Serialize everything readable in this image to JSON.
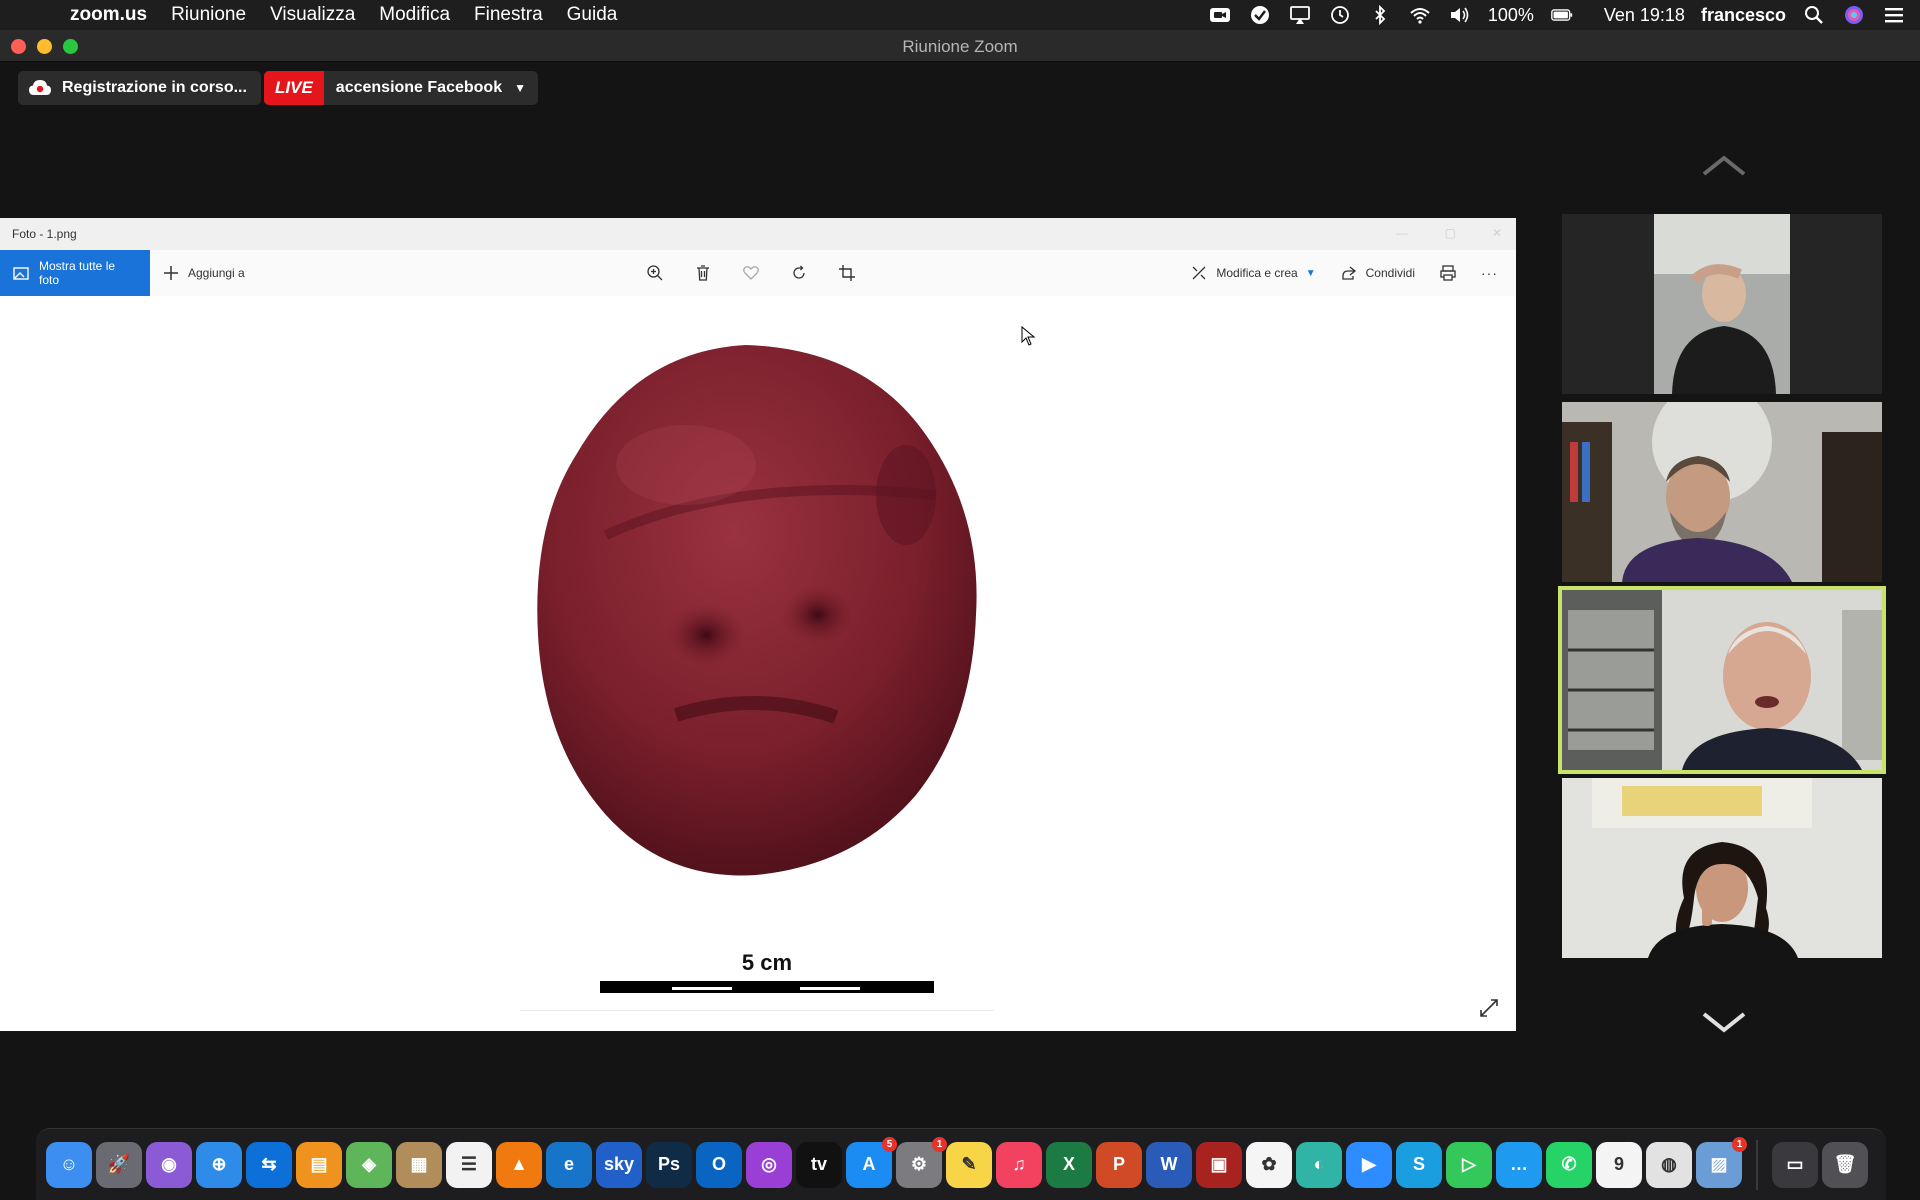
{
  "menubar": {
    "app_name": "zoom.us",
    "menus": [
      "Riunione",
      "Visualizza",
      "Modifica",
      "Finestra",
      "Guida"
    ],
    "battery": "100%",
    "clock": "Ven 19:18",
    "user": "francesco"
  },
  "zoom": {
    "window_title": "Riunione Zoom",
    "recording_label": "Registrazione in corso...",
    "live_badge": "LIVE",
    "live_label": "accensione Facebook"
  },
  "photos": {
    "title": "Foto - 1.png",
    "show_all_label": "Mostra tutte le foto",
    "add_label": "Aggiungi a",
    "edit_label": "Modifica e crea",
    "share_label": "Condividi",
    "more_label": "···",
    "scale_label": "5 cm"
  },
  "participants": [
    {
      "name": "",
      "active": false
    },
    {
      "name": "",
      "active": false
    },
    {
      "name": "",
      "active": true
    },
    {
      "name": "",
      "active": false
    }
  ],
  "dock": {
    "apps": [
      {
        "name": "finder",
        "glyph": "☺",
        "color": "#3c8ef0"
      },
      {
        "name": "launchpad",
        "glyph": "🚀",
        "color": "#6a6a72"
      },
      {
        "name": "siri",
        "glyph": "◉",
        "color": "#8b5bd6"
      },
      {
        "name": "safari",
        "glyph": "⊕",
        "color": "#2e8be8"
      },
      {
        "name": "teamviewer",
        "glyph": "⇆",
        "color": "#0d6fd8"
      },
      {
        "name": "books",
        "glyph": "▤",
        "color": "#f0921e"
      },
      {
        "name": "maps",
        "glyph": "◈",
        "color": "#5fb55a"
      },
      {
        "name": "contacts",
        "glyph": "▦",
        "color": "#b08d5a"
      },
      {
        "name": "reminders",
        "glyph": "☰",
        "color": "#f2f2f2"
      },
      {
        "name": "vlc",
        "glyph": "▲",
        "color": "#f07a10"
      },
      {
        "name": "edge",
        "glyph": "e",
        "color": "#1674c9"
      },
      {
        "name": "sky",
        "glyph": "sky",
        "color": "#2260c9"
      },
      {
        "name": "photoshop",
        "glyph": "Ps",
        "color": "#0f2b45"
      },
      {
        "name": "outlook",
        "glyph": "O",
        "color": "#0a64c2"
      },
      {
        "name": "podcasts",
        "glyph": "◎",
        "color": "#9a3fd6"
      },
      {
        "name": "apple-tv",
        "glyph": "tv",
        "color": "#111111"
      },
      {
        "name": "app-store",
        "glyph": "A",
        "color": "#1b8cf2",
        "badge": "5"
      },
      {
        "name": "system-preferences",
        "glyph": "⚙",
        "color": "#7b7b80",
        "badge": "1"
      },
      {
        "name": "notes",
        "glyph": "✎",
        "color": "#f7d546"
      },
      {
        "name": "music",
        "glyph": "♫",
        "color": "#f2425f"
      },
      {
        "name": "excel",
        "glyph": "X",
        "color": "#1c7a43"
      },
      {
        "name": "powerpoint",
        "glyph": "P",
        "color": "#d14a26"
      },
      {
        "name": "word",
        "glyph": "W",
        "color": "#2a5bb8"
      },
      {
        "name": "photo-booth",
        "glyph": "▣",
        "color": "#a8231f"
      },
      {
        "name": "photos",
        "glyph": "✿",
        "color": "#f5f5f5"
      },
      {
        "name": "messages-green",
        "glyph": "◐",
        "color": "#2fb4a6"
      },
      {
        "name": "zoom",
        "glyph": "▶",
        "color": "#2d8cff"
      },
      {
        "name": "skype",
        "glyph": "S",
        "color": "#1a9ee0"
      },
      {
        "name": "facetime",
        "glyph": "▷",
        "color": "#34c759"
      },
      {
        "name": "messages",
        "glyph": "…",
        "color": "#1e9af0"
      },
      {
        "name": "whatsapp",
        "glyph": "✆",
        "color": "#25d366"
      },
      {
        "name": "calendar",
        "glyph": "9",
        "color": "#f4f4f4"
      },
      {
        "name": "chrome",
        "glyph": "◍",
        "color": "#e2e2e2"
      },
      {
        "name": "preview",
        "glyph": "▨",
        "color": "#6a9cd6",
        "badge": "1"
      }
    ],
    "trailing": [
      {
        "name": "downloads-stack",
        "glyph": "▭",
        "color": "#3a3a3e"
      },
      {
        "name": "trash",
        "glyph": "🗑",
        "color": "#505055"
      }
    ]
  }
}
